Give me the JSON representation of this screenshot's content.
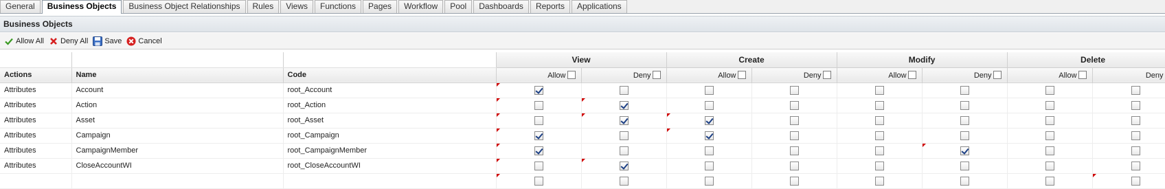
{
  "tabs": [
    {
      "label": "General",
      "active": false
    },
    {
      "label": "Business Objects",
      "active": true
    },
    {
      "label": "Business Object Relationships",
      "active": false
    },
    {
      "label": "Rules",
      "active": false
    },
    {
      "label": "Views",
      "active": false
    },
    {
      "label": "Functions",
      "active": false
    },
    {
      "label": "Pages",
      "active": false
    },
    {
      "label": "Workflow",
      "active": false
    },
    {
      "label": "Pool",
      "active": false
    },
    {
      "label": "Dashboards",
      "active": false
    },
    {
      "label": "Reports",
      "active": false
    },
    {
      "label": "Applications",
      "active": false
    }
  ],
  "panel": {
    "title": "Business Objects"
  },
  "toolbar": {
    "allow_all": "Allow All",
    "deny_all": "Deny All",
    "save": "Save",
    "cancel": "Cancel"
  },
  "grid": {
    "groups": [
      "View",
      "Create",
      "Modify",
      "Delete"
    ],
    "columns": {
      "actions": "Actions",
      "name": "Name",
      "code": "Code",
      "allow": "Allow",
      "deny": "Deny"
    },
    "rows": [
      {
        "action": "Attributes",
        "name": "Account",
        "code": "root_Account",
        "perms": [
          true,
          false,
          false,
          false,
          false,
          false,
          false,
          false
        ],
        "dirty": [
          true,
          false,
          false,
          false,
          false,
          false,
          false,
          false
        ]
      },
      {
        "action": "Attributes",
        "name": "Action",
        "code": "root_Action",
        "perms": [
          false,
          true,
          false,
          false,
          false,
          false,
          false,
          false
        ],
        "dirty": [
          true,
          true,
          false,
          false,
          false,
          false,
          false,
          false
        ]
      },
      {
        "action": "Attributes",
        "name": "Asset",
        "code": "root_Asset",
        "perms": [
          false,
          true,
          true,
          false,
          false,
          false,
          false,
          false
        ],
        "dirty": [
          true,
          true,
          true,
          false,
          false,
          false,
          false,
          false
        ]
      },
      {
        "action": "Attributes",
        "name": "Campaign",
        "code": "root_Campaign",
        "perms": [
          true,
          false,
          true,
          false,
          false,
          false,
          false,
          false
        ],
        "dirty": [
          true,
          false,
          true,
          false,
          false,
          false,
          false,
          false
        ]
      },
      {
        "action": "Attributes",
        "name": "CampaignMember",
        "code": "root_CampaignMember",
        "perms": [
          true,
          false,
          false,
          false,
          false,
          true,
          false,
          false
        ],
        "dirty": [
          true,
          false,
          false,
          false,
          false,
          true,
          false,
          false
        ]
      },
      {
        "action": "Attributes",
        "name": "CloseAccountWI",
        "code": "root_CloseAccountWI",
        "perms": [
          false,
          true,
          false,
          false,
          false,
          false,
          false,
          false
        ],
        "dirty": [
          true,
          true,
          false,
          false,
          false,
          false,
          false,
          false
        ]
      },
      {
        "action": "",
        "name": "",
        "code": "",
        "perms": [
          false,
          false,
          false,
          false,
          false,
          false,
          false,
          false
        ],
        "dirty": [
          true,
          false,
          false,
          false,
          false,
          false,
          false,
          true
        ]
      }
    ]
  }
}
